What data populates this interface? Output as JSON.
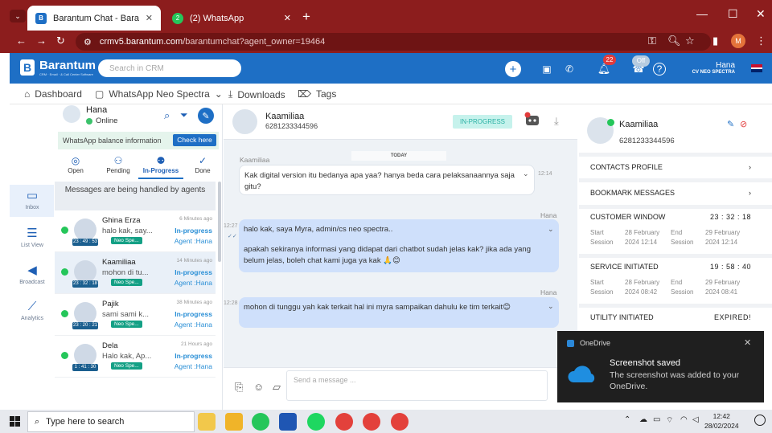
{
  "browser": {
    "tabs": [
      {
        "title": "Barantum Chat - Barantum CRM",
        "active": true
      },
      {
        "title": "(2) WhatsApp",
        "active": false
      }
    ],
    "url_host": "crmv5.barantum.com",
    "url_path": "/barantumchat?agent_owner=19464",
    "profile_initial": "M"
  },
  "app": {
    "logo_name": "Barantum",
    "logo_sub": "CRM · Email · & Call Center Software",
    "search_placeholder": "Search in CRM",
    "notif_count": "22",
    "status_toggle": "Off",
    "user_name": "Hana",
    "user_company": "CV NEO SPECTRA"
  },
  "nav": [
    "Dashboard",
    "WhatsApp Neo Spectra",
    "Downloads",
    "Tags"
  ],
  "rail": [
    "Inbox",
    "List View",
    "Broadcast",
    "Analytics"
  ],
  "agent": {
    "name": "Hana",
    "status": "Online"
  },
  "wa_balance": {
    "label": "WhatsApp balance information",
    "button": "Check here"
  },
  "status_tabs": [
    "Open",
    "Pending",
    "In-Progress",
    "Done"
  ],
  "handled_text": "Messages are being handled by agents",
  "conversations": [
    {
      "name": "Ghina Erza",
      "time": "6 Minutes ago",
      "preview": "halo kak, say...",
      "status": "In-progress",
      "timer": "23 : 49 : 53",
      "tag": "Neo Spe...",
      "agent": "Agent :Hana"
    },
    {
      "name": "Kaamiliaa",
      "time": "14 Minutes ago",
      "preview": "mohon di tu...",
      "status": "In-progress",
      "timer": "23 : 32 : 18",
      "tag": "Neo Spe...",
      "agent": "Agent :Hana"
    },
    {
      "name": "Pajik",
      "time": "38 Minutes ago",
      "preview": "sami sami k...",
      "status": "In-progress",
      "timer": "23 : 20 : 21",
      "tag": "Neo Spe...",
      "agent": "Agent :Hana"
    },
    {
      "name": "Dela",
      "time": "21 Hours ago",
      "preview": "Halo kak, Ap...",
      "status": "In-progress",
      "timer": "1 : 41 : 30",
      "tag": "Neo Spe...",
      "agent": "Agent :Hana"
    }
  ],
  "chat": {
    "contact_name": "Kaamiliaa",
    "contact_phone": "6281233344596",
    "status": "IN-PROGRESS",
    "day_label": "TODAY",
    "messages": [
      {
        "sender": "Kaamiliaa",
        "text": "Kak digital version itu bedanya apa yaa? hanya beda cara pelaksanaannya saja gitu?",
        "time": "12:14"
      },
      {
        "sender": "Hana",
        "time": "12:27",
        "text_l1": "halo kak, saya Myra, admin/cs neo spectra..",
        "text_l2": "apakah sekiranya informasi yang didapat dari chatbot sudah jelas kak? jika ada yang belum jelas, boleh chat kami juga ya kak 🙏😊"
      },
      {
        "sender": "Hana",
        "time": "12:28",
        "text": "mohon di tunggu yah kak terkait hal ini myra sampaikan dahulu ke tim terkait😊"
      }
    ],
    "composer_placeholder": "Send a message ..."
  },
  "contact": {
    "name": "Kaamiliaa",
    "phone": "6281233344596",
    "profile": "CONTACTS PROFILE",
    "bookmark": "BOOKMARK MESSAGES",
    "customer_window": {
      "title": "CUSTOMER WINDOW",
      "value": "23 : 32 : 18",
      "start_label": "Start Session",
      "start": "28 February 2024 12:14",
      "end_label": "End Session",
      "end": "29 February 2024 12:14"
    },
    "service_initiated": {
      "title": "SERVICE INITIATED",
      "value": "19 : 58 : 40",
      "start_label": "Start Session",
      "start": "28 February 2024 08:42",
      "end_label": "End Session",
      "end": "29 February 2024 08:41"
    },
    "utility_initiated": {
      "title": "UTILITY INITIATED",
      "value": "EXPIRED!"
    }
  },
  "toast": {
    "app": "OneDrive",
    "title": "Screenshot saved",
    "body": "The screenshot was added to your OneDrive."
  },
  "taskbar": {
    "search": "Type here to search",
    "time": "12:42",
    "date": "28/02/2024"
  }
}
